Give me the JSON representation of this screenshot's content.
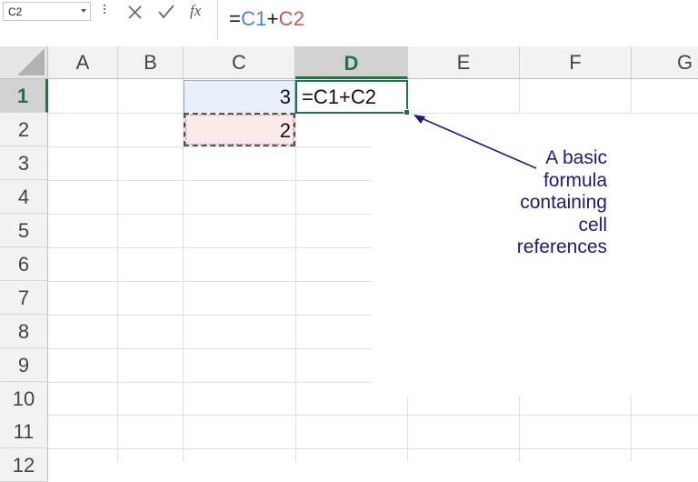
{
  "name_box": {
    "value": "C2"
  },
  "formula_bar": {
    "fx_label": "fx",
    "formula_parts": [
      {
        "text": "=",
        "color": "#1a1a1a"
      },
      {
        "text": "C1",
        "color": "#4a86c8"
      },
      {
        "text": "+",
        "color": "#1a1a1a"
      },
      {
        "text": "C2",
        "color": "#c55a56"
      }
    ]
  },
  "columns": [
    "A",
    "B",
    "C",
    "D",
    "E",
    "F",
    "G"
  ],
  "selected_column": "D",
  "rows": [
    "1",
    "2",
    "3",
    "4",
    "5",
    "6",
    "7",
    "8",
    "9",
    "10",
    "11",
    "12"
  ],
  "selected_row": "1",
  "cells": {
    "C1": "3",
    "C2": "2",
    "D1": "=C1+C2"
  },
  "colors": {
    "accent": "#217346",
    "ref1_highlight": "#e9f0fb",
    "ref2_highlight": "#fbeaea",
    "annotation": "#1a1a80"
  },
  "annotation": {
    "lines": [
      "A basic",
      "formula",
      "containing",
      "cell",
      "references"
    ]
  }
}
